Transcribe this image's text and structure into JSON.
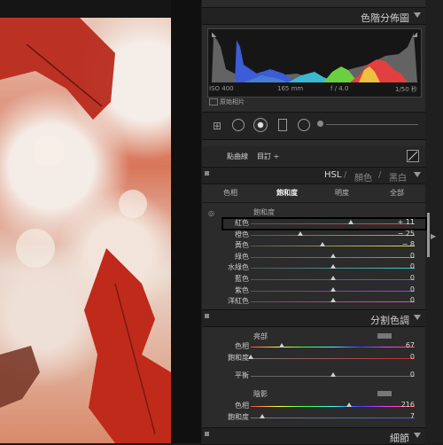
{
  "histogram_panel": {
    "title": "色階分佈圖",
    "iso": "ISO 400",
    "focal": "165 mm",
    "aperture": "f / 4.0",
    "shutter": "1/50 秒",
    "original_photo_label": "原始相片"
  },
  "tone_curve": {
    "point_curve_label": "點曲線",
    "point_curve_value": "目訂 ÷"
  },
  "hsl_panel": {
    "title_hsl": "HSL",
    "sep1": "/",
    "title_color": "顏色",
    "sep2": "/",
    "title_bw": "黑白",
    "tabs": [
      "色相",
      "飽和度",
      "明度",
      "全部"
    ],
    "active_tab": "飽和度",
    "group_label": "飽和度",
    "rows": [
      {
        "label": "紅色",
        "value": "+ 11",
        "level": 0.61,
        "color_a": "#ff4040",
        "color_b": "#ff4040"
      },
      {
        "label": "橙色",
        "value": "− 25",
        "level": 0.3,
        "color_a": "#ff9933",
        "color_b": "#ff9933"
      },
      {
        "label": "黃色",
        "value": "− 8",
        "level": 0.44,
        "color_a": "#f0e040",
        "color_b": "#f0e040"
      },
      {
        "label": "綠色",
        "value": "0",
        "level": 0.5,
        "color_a": "#40d040",
        "color_b": "#40d040"
      },
      {
        "label": "水綠色",
        "value": "0",
        "level": 0.5,
        "color_a": "#40d0d0",
        "color_b": "#40d0d0"
      },
      {
        "label": "藍色",
        "value": "0",
        "level": 0.5,
        "color_a": "#4060ff",
        "color_b": "#4060ff"
      },
      {
        "label": "紫色",
        "value": "0",
        "level": 0.5,
        "color_a": "#9040ff",
        "color_b": "#9040ff"
      },
      {
        "label": "洋紅色",
        "value": "0",
        "level": 0.5,
        "color_a": "#ff40c0",
        "color_b": "#ff40c0"
      }
    ]
  },
  "split_toning": {
    "title": "分割色調",
    "highlights": "亮部",
    "hue_label": "色相",
    "hue_value": "67",
    "hue_level": 0.19,
    "sat_label": "飽和度",
    "sat_value": "0",
    "sat_level": 0.0,
    "balance_label": "平衡",
    "balance_value": "0",
    "balance_level": 0.5,
    "shadows": "陰影",
    "shadow_hue_label": "色相",
    "shadow_hue_value": "216",
    "shadow_hue_level": 0.6,
    "shadow_sat_label": "飽和度",
    "shadow_sat_value": "7",
    "shadow_sat_level": 0.07
  },
  "detail_panel": {
    "title": "細節"
  }
}
